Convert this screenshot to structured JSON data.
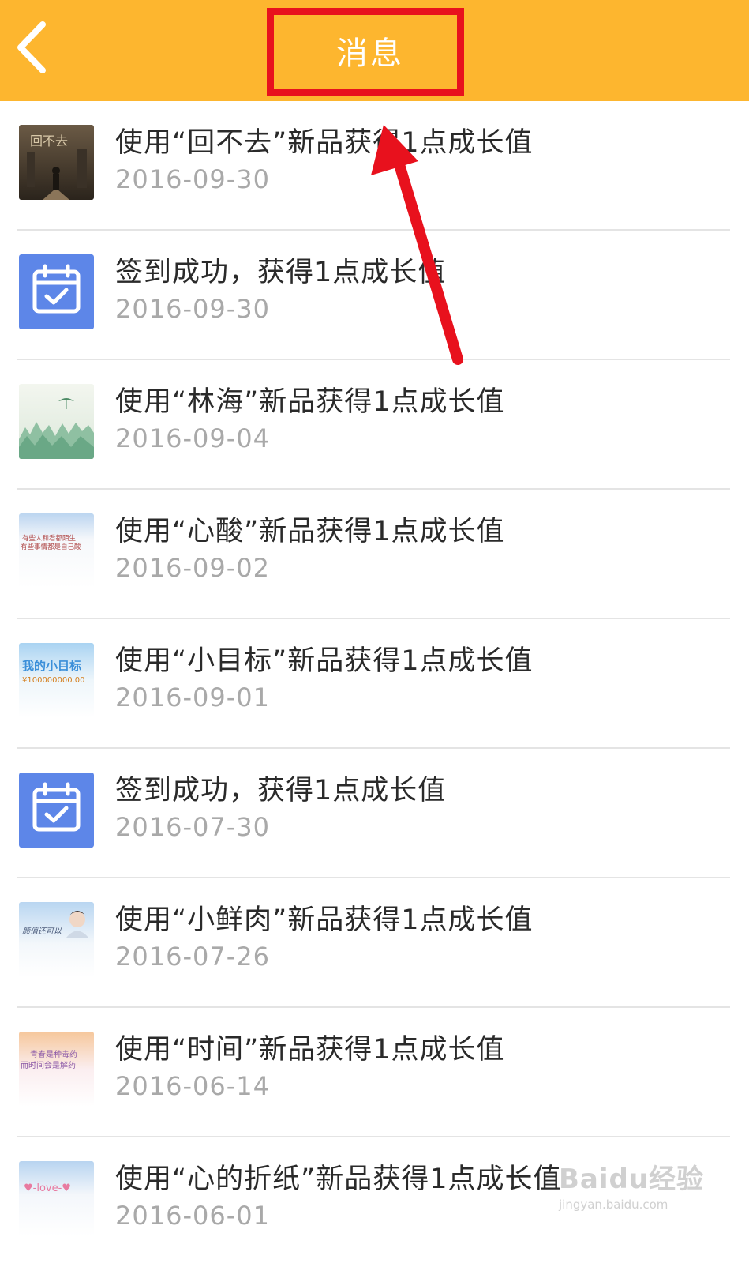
{
  "header": {
    "title": "消息",
    "back_icon": "chevron-left-icon",
    "background": "#fdb62f"
  },
  "messages": [
    {
      "text": "使用“回不去”新品获得1点成长值",
      "date": "2016-09-30",
      "thumb": "dark-poster-thumbnail",
      "thumb_text": "回不去"
    },
    {
      "text": "签到成功，获得1点成长值",
      "date": "2016-09-30",
      "thumb": "calendar-check-icon"
    },
    {
      "text": "使用“林海”新品获得1点成长值",
      "date": "2016-09-04",
      "thumb": "forest-paraglider-thumbnail"
    },
    {
      "text": "使用“心酸”新品获得1点成长值",
      "date": "2016-09-02",
      "thumb": "text-card-thumbnail",
      "thumb_text": "有些人和看都陌生\n有些事情都是自己酸"
    },
    {
      "text": "使用“小目标”新品获得1点成长值",
      "date": "2016-09-01",
      "thumb": "goal-card-thumbnail",
      "thumb_text": "我的小目标\n¥100000000.00"
    },
    {
      "text": "签到成功，获得1点成长值",
      "date": "2016-07-30",
      "thumb": "calendar-check-icon"
    },
    {
      "text": "使用“小鲜肉”新品获得1点成长值",
      "date": "2016-07-26",
      "thumb": "portrait-card-thumbnail",
      "thumb_text": "颜值还可以"
    },
    {
      "text": "使用“时间”新品获得1点成长值",
      "date": "2016-06-14",
      "thumb": "pastel-text-thumbnail",
      "thumb_text": "青春是种毒药\n而时间会是解药"
    },
    {
      "text": "使用“心的折纸”新品获得1点成长值",
      "date": "2016-06-01",
      "thumb": "love-card-thumbnail",
      "thumb_text": "♥-love-♥"
    }
  ],
  "annotation": {
    "highlight_color": "#e8111d"
  },
  "watermark": {
    "logo": "Baidu经验",
    "url": "jingyan.baidu.com"
  }
}
